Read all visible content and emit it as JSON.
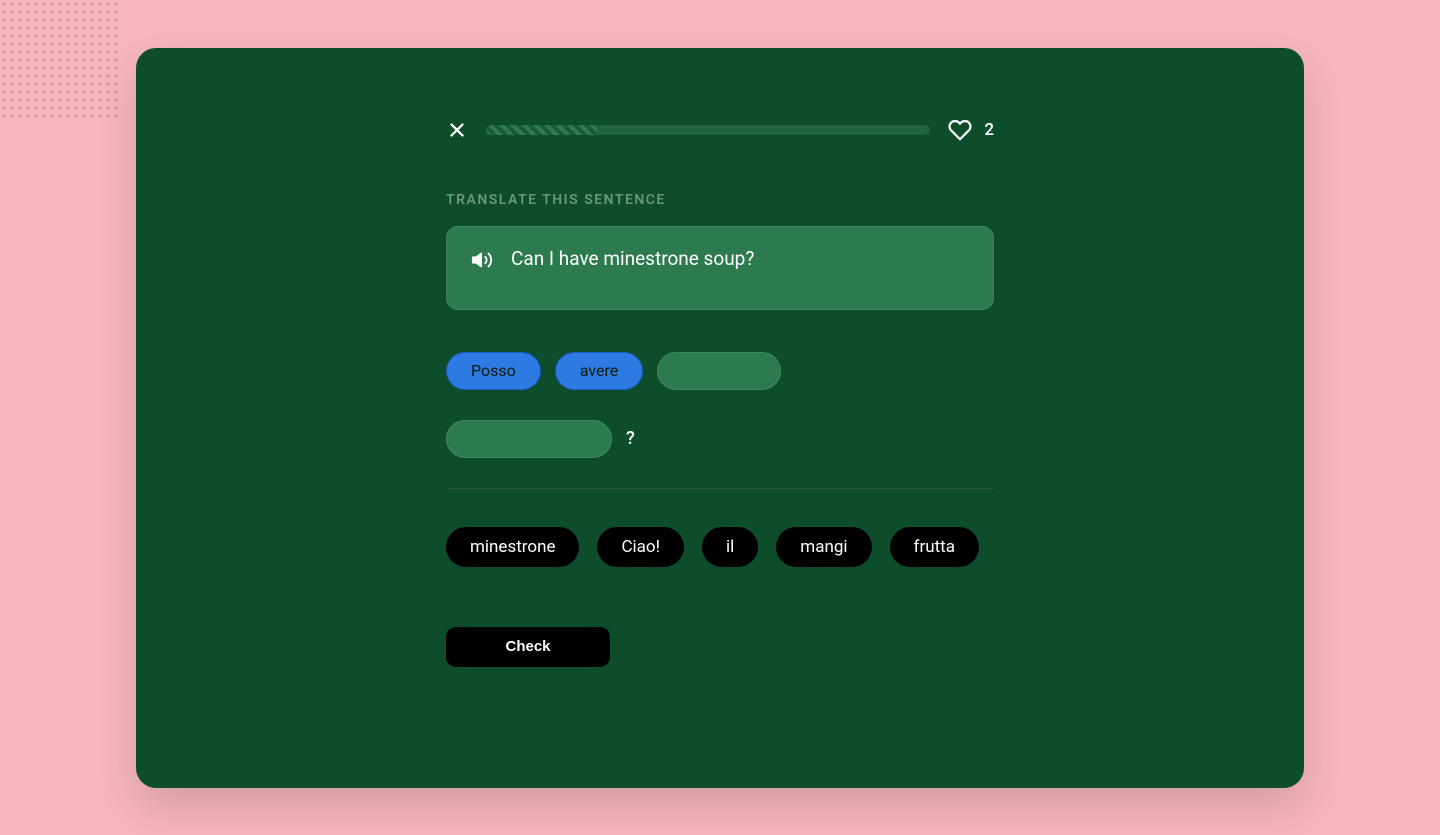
{
  "header": {
    "lives": "2",
    "progress_percent": 25
  },
  "instruction": "TRANSLATE THIS SENTENCE",
  "prompt": {
    "sentence": "Can I have minestrone soup?"
  },
  "answer": {
    "filled": [
      "Posso",
      "avere"
    ],
    "trailing": "?"
  },
  "bank": [
    "minestrone",
    "Ciao!",
    "il",
    "mangi",
    "frutta"
  ],
  "actions": {
    "check": "Check"
  }
}
